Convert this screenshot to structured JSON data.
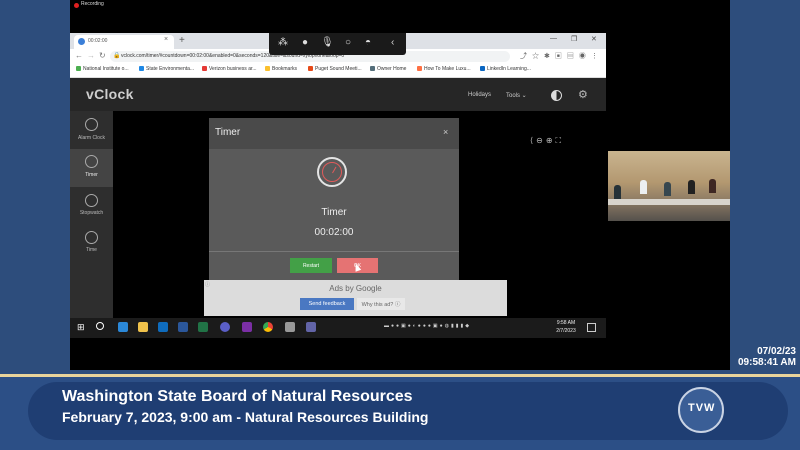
{
  "recording": {
    "label": "Recording"
  },
  "browser": {
    "tab_title": "00:02:00",
    "url": "vclock.com/timer/#countdown=00:02:00&enabled=0&seconds=120&title=&sound=xylophone&loop=0",
    "bookmarks": [
      {
        "label": "National Institute o...",
        "color": "#4caf50"
      },
      {
        "label": "State Environmenta...",
        "color": "#1e88e5"
      },
      {
        "label": "Verizon business ar...",
        "color": "#e53935"
      },
      {
        "label": "Bookmarks",
        "color": "#fbc02d"
      },
      {
        "label": "Puget Sound Meeti...",
        "color": "#e64a19"
      },
      {
        "label": "Owner Home",
        "color": "#546e7a"
      },
      {
        "label": "How To Make Luxu...",
        "color": "#ff7043"
      },
      {
        "label": "LinkedIn Learning...",
        "color": "#0a66c2"
      }
    ]
  },
  "vclock": {
    "logo": "vClock",
    "nav": {
      "holidays": "Holidays",
      "tools": "Tools ⌄"
    },
    "sidebar": [
      {
        "label": "Alarm Clock",
        "icon": "alarm-clock-icon"
      },
      {
        "label": "Timer",
        "icon": "timer-icon",
        "active": true
      },
      {
        "label": "Stopwatch",
        "icon": "stopwatch-icon"
      },
      {
        "label": "Time",
        "icon": "clock-icon"
      }
    ],
    "dialog": {
      "title": "Timer",
      "close": "×",
      "label": "Timer",
      "time": "00:02:00",
      "restart": "Restart",
      "ok": "OK"
    },
    "ad": {
      "text": "Ads by Google",
      "feedback": "Send feedback",
      "why": "Why this ad? ⓘ"
    }
  },
  "taskbar": {
    "time": "9:58 AM",
    "date": "2/7/2023"
  },
  "overlay": {
    "date": "07/02/23",
    "time": "09:58:41 AM"
  },
  "lower_third": {
    "title": "Washington State Board of Natural Resources",
    "subtitle": "February 7, 2023, 9:00 am - Natural Resources Building",
    "logo_text": "TVW"
  }
}
